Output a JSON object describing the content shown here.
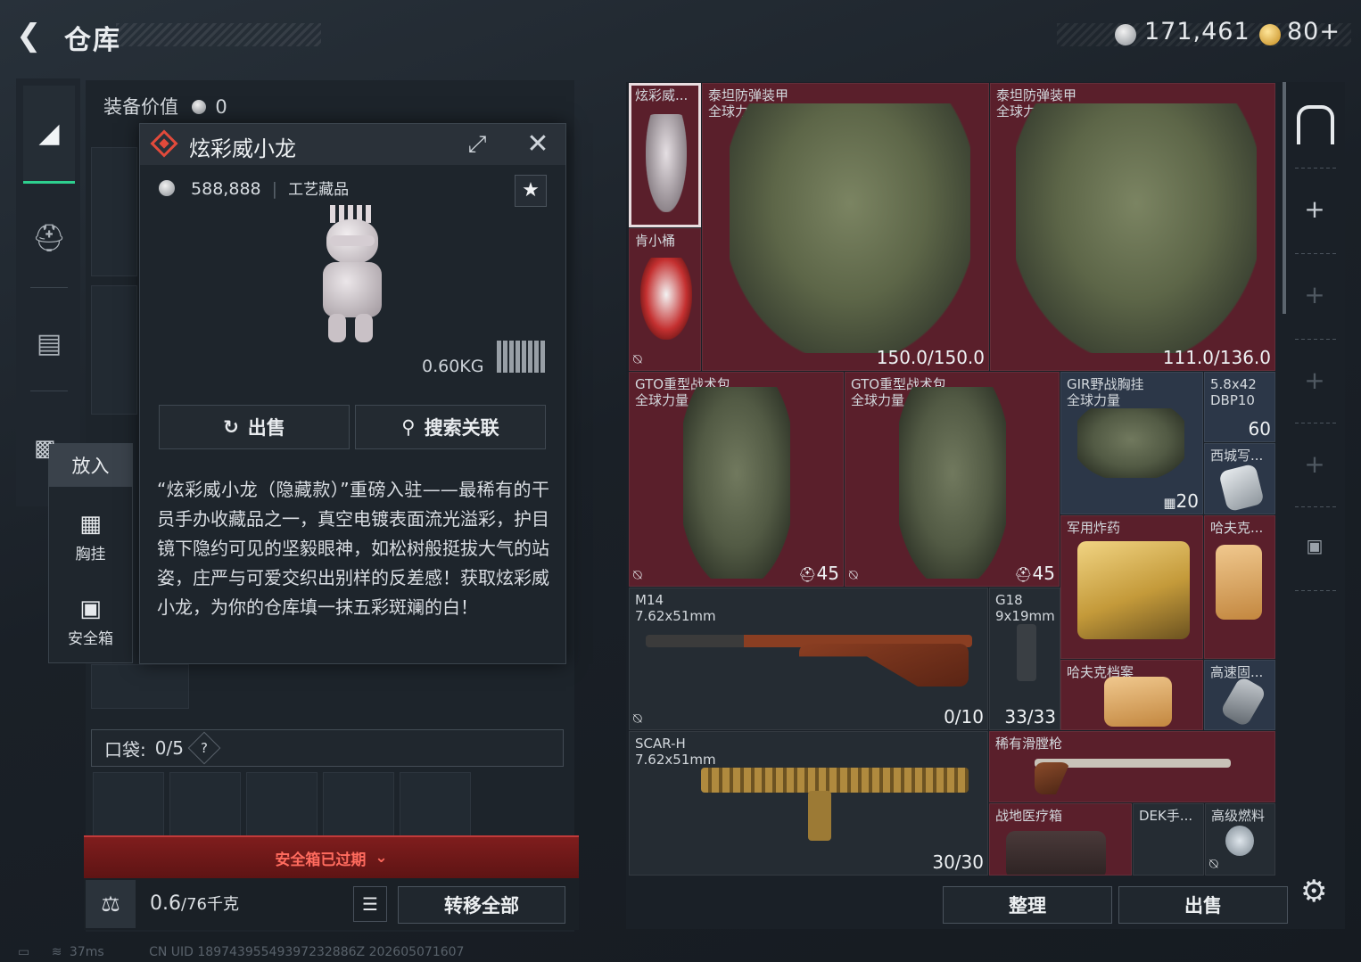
{
  "header": {
    "title": "仓库",
    "currency_silver": "171,461",
    "currency_gold": "80+"
  },
  "tabs": [
    {
      "icon": "pistol-icon",
      "active": true
    },
    {
      "icon": "helmet-icon"
    },
    {
      "icon": "vest-icon"
    },
    {
      "icon": "briefcase-icon"
    }
  ],
  "loadout": {
    "value_label": "装备价值",
    "value": "0"
  },
  "popup": {
    "name": "炫彩威小龙",
    "price": "588,888",
    "category": "工艺藏品",
    "weight": "0.60KG",
    "sell_label": "出售",
    "search_label": "搜索关联",
    "description": "“炫彩威小龙（隐藏款）”重磅入驻——最稀有的干员手办收藏品之一，真空电镀表面流光溢彩，护目镜下隐约可见的坚毅眼神，如松树般挺拔大气的站姿，庄严与可爱交织出别样的反差感！获取炫彩威小龙，为你的仓库填一抹五彩斑斓的白！"
  },
  "put_menu": {
    "title": "放入",
    "items": [
      {
        "label": "胸挂",
        "icon": "chest-rig-icon"
      },
      {
        "label": "安全箱",
        "icon": "safe-box-icon"
      }
    ]
  },
  "pocket": {
    "label": "口袋:",
    "value": "0/5",
    "help": "?"
  },
  "safe_box": {
    "expired_label": "安全箱已过期"
  },
  "capacity": {
    "value": "0.6",
    "max": "/76千克"
  },
  "transfer_all_label": "转移全部",
  "status": {
    "ping": "37ms",
    "uid": "CN UID 18974395549397232886Z 202605071607"
  },
  "stash": {
    "items": [
      {
        "name": "炫彩威...",
        "selected": true
      },
      {
        "name": "肯小桶"
      },
      {
        "name": "泰坦防弹装甲\n全球力量",
        "value": "150.0/150.0"
      },
      {
        "name": "泰坦防弹装甲\n全球力量",
        "value": "111.0/136.0"
      },
      {
        "name": "GTO重型战术包\n全球力量",
        "value": "45"
      },
      {
        "name": "GTO重型战术包\n全球力量",
        "value": "45"
      },
      {
        "name": "GIR野战胸挂\n全球力量",
        "value": "20"
      },
      {
        "name": "5.8x42\nDBP10",
        "value": "60"
      },
      {
        "name": "西城写..."
      },
      {
        "name": "军用炸药"
      },
      {
        "name": "哈夫克..."
      },
      {
        "name": "M14\n7.62x51mm",
        "value": "0/10"
      },
      {
        "name": "G18\n9x19mm",
        "value": "33/33"
      },
      {
        "name": "哈夫克档案"
      },
      {
        "name": "高速固..."
      },
      {
        "name": "SCAR-H\n7.62x51mm",
        "value": "30/30"
      },
      {
        "name": "稀有滑膛枪"
      },
      {
        "name": "战地医疗箱"
      },
      {
        "name": "DEK手..."
      },
      {
        "name": "高级燃料"
      }
    ],
    "arrange_label": "整理",
    "sell_label": "出售"
  },
  "colors": {
    "accent": "#2ecf8e",
    "rarity_red": "#5a1f2b",
    "warning": "#ff6b5e"
  }
}
